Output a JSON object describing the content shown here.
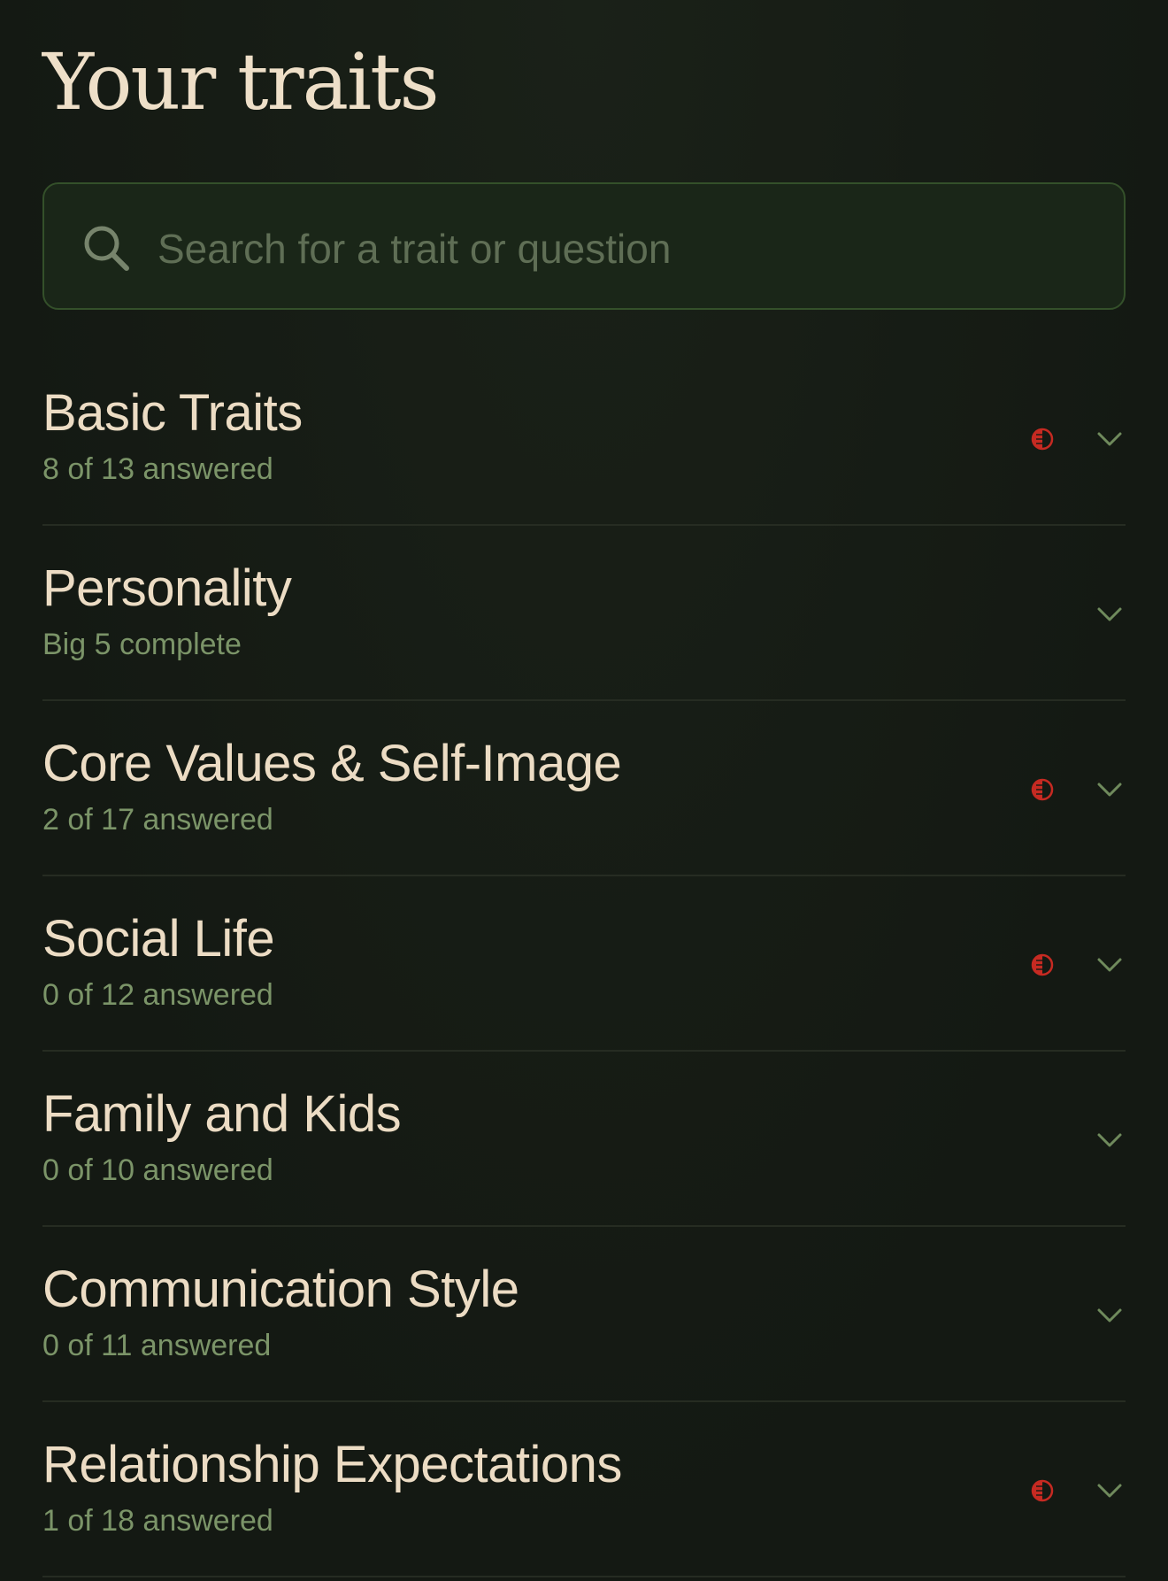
{
  "header": {
    "title": "Your traits"
  },
  "search": {
    "placeholder": "Search for a trait or question",
    "value": ""
  },
  "colors": {
    "background": "#151a14",
    "title_text": "#eedfc8",
    "subtitle_text": "#7b9468",
    "search_border": "#34502a",
    "alert": "#c62a22",
    "chevron": "#6f8a5c"
  },
  "traits": [
    {
      "name": "Basic Traits",
      "status": "8 of 13 answered",
      "alert": true
    },
    {
      "name": "Personality",
      "status": "Big 5 complete",
      "alert": false
    },
    {
      "name": "Core Values & Self-Image",
      "status": "2 of 17 answered",
      "alert": true
    },
    {
      "name": "Social Life",
      "status": "0 of 12 answered",
      "alert": true
    },
    {
      "name": "Family and Kids",
      "status": "0 of 10 answered",
      "alert": false
    },
    {
      "name": "Communication Style",
      "status": "0 of 11 answered",
      "alert": false
    },
    {
      "name": "Relationship Expectations",
      "status": "1 of 18 answered",
      "alert": true
    }
  ]
}
